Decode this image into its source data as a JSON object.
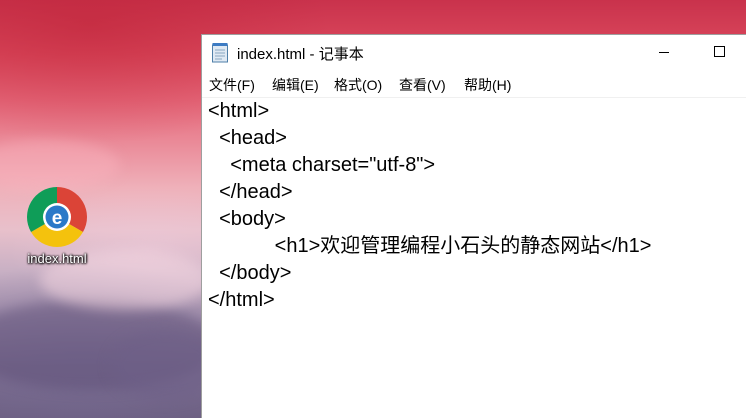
{
  "desktop": {
    "icons": [
      {
        "label": "index.html",
        "icon": "legacy-edge-browser-icon",
        "colors": {
          "red": "#db4437",
          "yellow": "#f4c20d",
          "green": "#0f9d58",
          "blue": "#2a79c8"
        }
      }
    ]
  },
  "notepad": {
    "title": "index.html - 记事本",
    "title_icon": "notepad-icon",
    "controls": {
      "minimize": "minimize-icon",
      "maximize": "maximize-icon"
    },
    "menu": [
      {
        "label": "文件(F)"
      },
      {
        "label": "编辑(E)"
      },
      {
        "label": "格式(O)"
      },
      {
        "label": "查看(V)"
      },
      {
        "label": "帮助(H)"
      }
    ],
    "content_lines": [
      "<html>",
      "  <head>",
      "    <meta charset=\"utf-8\">",
      "  </head>",
      "  <body>",
      "            <h1>欢迎管理编程小石头的静态网站</h1>",
      "  </body>",
      "</html>"
    ]
  }
}
